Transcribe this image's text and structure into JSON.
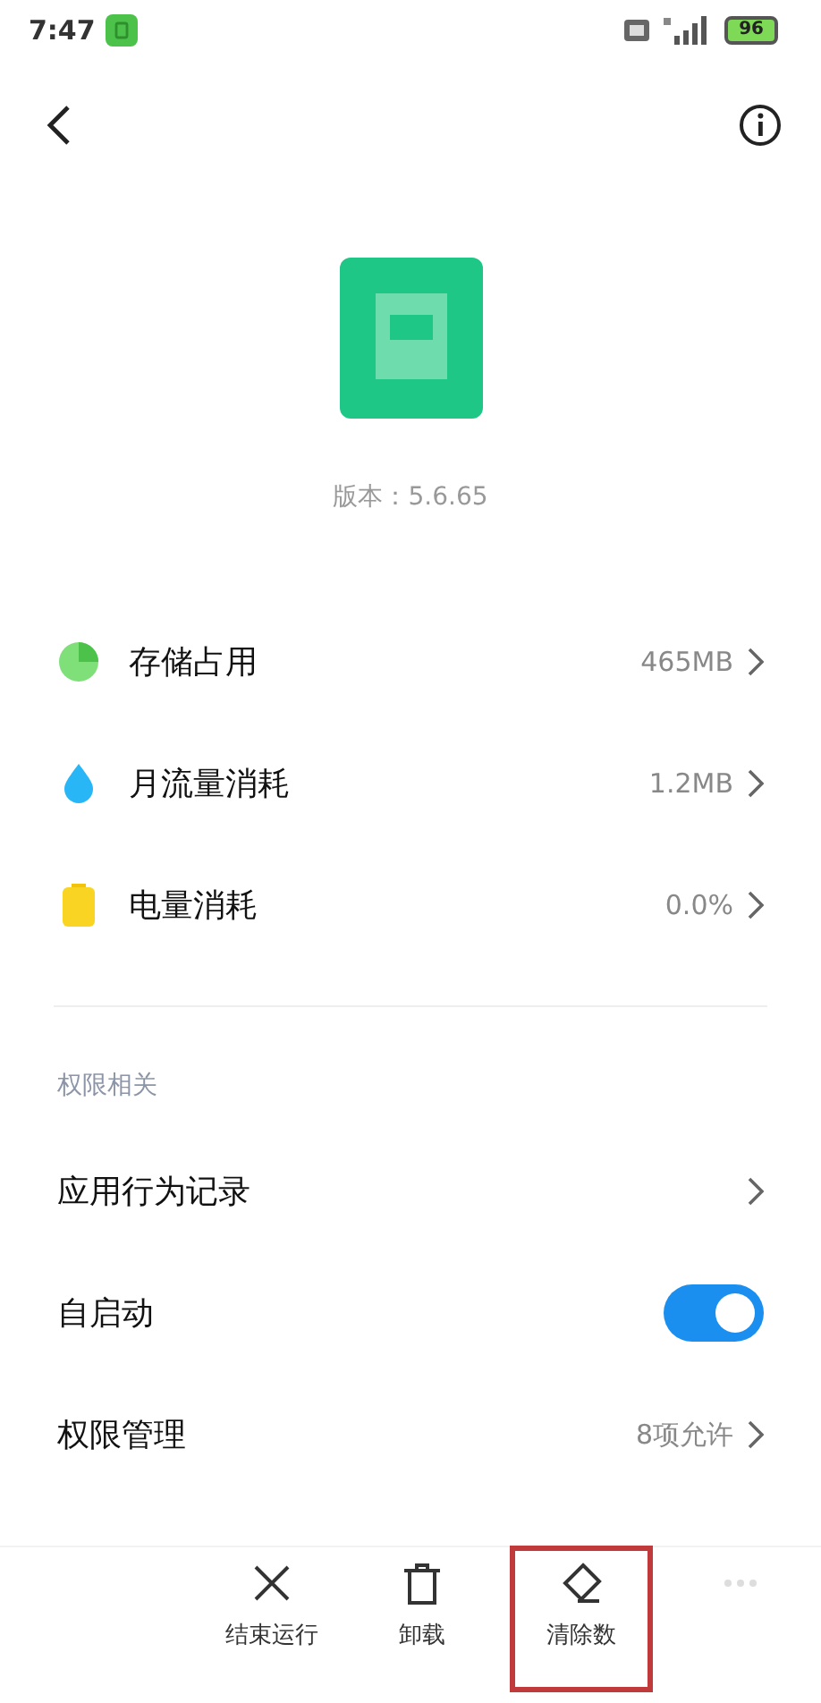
{
  "status_bar": {
    "time": "7:47",
    "battery": "96"
  },
  "app": {
    "version": "版本：5.6.65"
  },
  "usage_rows": [
    {
      "kind": "storage",
      "label": "存储占用",
      "value": "465MB"
    },
    {
      "kind": "traffic",
      "label": "月流量消耗",
      "value": "1.2MB"
    },
    {
      "kind": "battery",
      "label": "电量消耗",
      "value": "0.0%"
    }
  ],
  "section_title": "权限相关",
  "permission_rows": [
    {
      "kind": "link",
      "label": "应用行为记录"
    },
    {
      "kind": "switch",
      "label": "自启动",
      "on": true
    },
    {
      "kind": "link",
      "label": "权限管理",
      "value": "8项允许"
    }
  ],
  "actions": [
    {
      "kind": "stop",
      "label": "结束运行",
      "highlighted": false
    },
    {
      "kind": "uninstall",
      "label": "卸载",
      "highlighted": false
    },
    {
      "kind": "clear",
      "label": "清除数",
      "highlighted": true
    },
    {
      "kind": "more",
      "highlighted": false
    }
  ]
}
